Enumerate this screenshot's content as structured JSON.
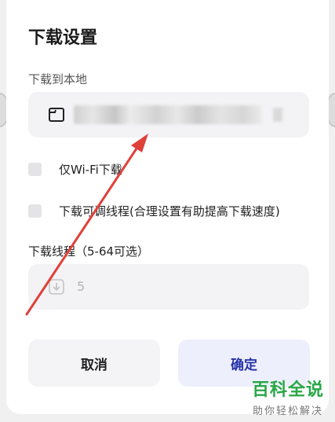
{
  "dialog": {
    "title": "下载设置",
    "download_location_label": "下载到本地",
    "options": [
      {
        "label": "仅Wi-Fi下载",
        "checked": false
      },
      {
        "label": "下载可调线程(合理设置有助提高下载速度)",
        "checked": false
      }
    ],
    "threads_label": "下载线程（5-64可选）",
    "threads_value": "5",
    "cancel_label": "取消",
    "confirm_label": "确定"
  },
  "watermark": {
    "logo": "百科全说",
    "subtitle": "助你轻松解决"
  },
  "colors": {
    "confirm_text": "#2633a8",
    "confirm_bg": "#eeeffd",
    "annotation_arrow": "#e0403a",
    "watermark_green": "#27a745"
  }
}
